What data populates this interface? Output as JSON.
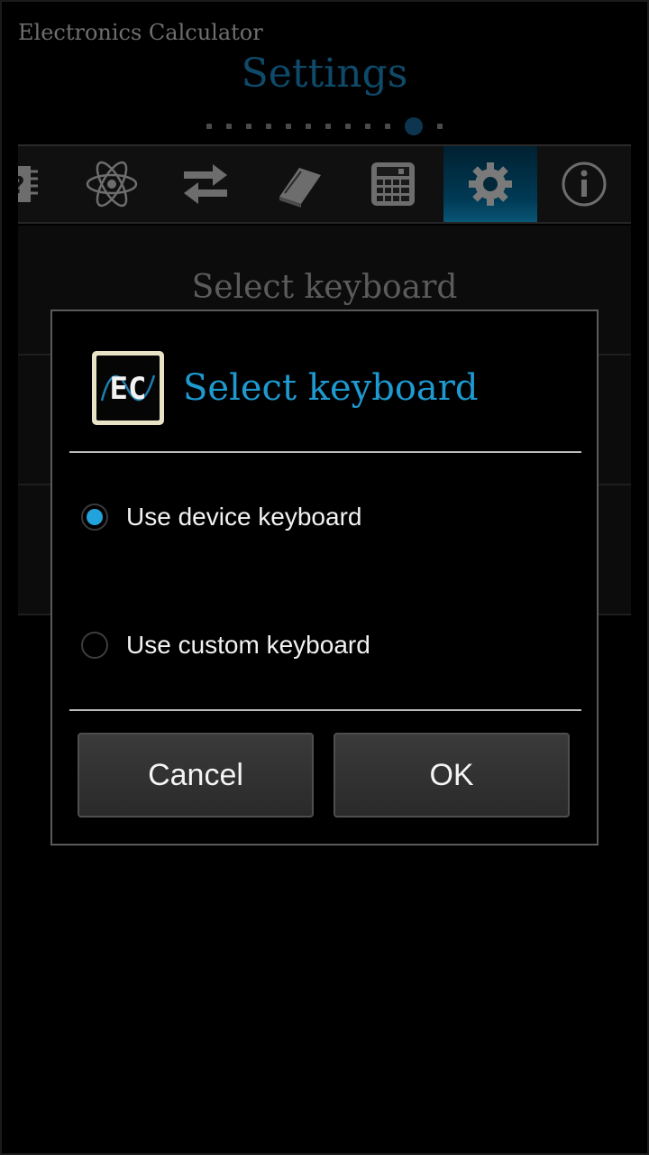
{
  "app": {
    "title": "Electronics Calculator",
    "page_title": "Settings",
    "page_indicator": {
      "total": 12,
      "current": 11
    }
  },
  "tabs": [
    {
      "icon": "chip-question-icon",
      "active": false
    },
    {
      "icon": "atom-icon",
      "active": false
    },
    {
      "icon": "swap-arrows-icon",
      "active": false
    },
    {
      "icon": "book-icon",
      "active": false
    },
    {
      "icon": "calculator-icon",
      "active": false
    },
    {
      "icon": "gear-icon",
      "active": true
    },
    {
      "icon": "info-icon",
      "active": false
    }
  ],
  "background": {
    "heading": "Select keyboard"
  },
  "dialog": {
    "icon": "ec-app-icon",
    "title": "Select keyboard",
    "options": [
      {
        "label": "Use device keyboard",
        "selected": true
      },
      {
        "label": "Use custom keyboard",
        "selected": false
      }
    ],
    "cancel_label": "Cancel",
    "ok_label": "OK"
  },
  "colors": {
    "accent": "#23a3dc",
    "title_blue": "#0e4a6a",
    "active_tab": "#003a55"
  }
}
